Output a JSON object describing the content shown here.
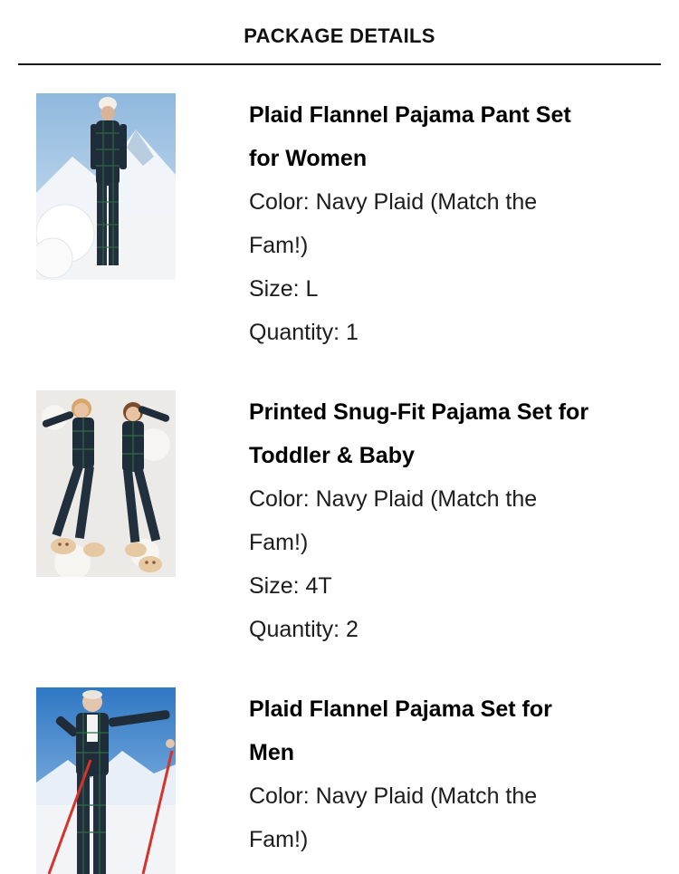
{
  "header": {
    "title": "PACKAGE DETAILS"
  },
  "items": [
    {
      "name_lines": [
        "Plaid Flannel Pajama Pant Set",
        "for Women"
      ],
      "color_lines": [
        "Color: Navy Plaid (Match the",
        "Fam!)"
      ],
      "size": "Size: L",
      "quantity": "Quantity: 1",
      "image_icon": "woman-in-plaid-pajamas-photo"
    },
    {
      "name_lines": [
        "Printed Snug-Fit Pajama Set for",
        "Toddler & Baby"
      ],
      "color_lines": [
        "Color: Navy Plaid (Match the",
        "Fam!)"
      ],
      "size": "Size: 4T",
      "quantity": "Quantity: 2",
      "image_icon": "kids-in-plaid-pajamas-photo"
    },
    {
      "name_lines": [
        "Plaid Flannel Pajama Set for",
        "Men"
      ],
      "color_lines": [
        "Color: Navy Plaid (Match the",
        "Fam!)"
      ],
      "image_icon": "man-in-plaid-pajamas-photo"
    }
  ],
  "colors": {
    "plaid_navy": "#1f2c3a",
    "plaid_green": "#2f5a3e",
    "sky_blue": "#a9c9e6",
    "snow": "#eef1f4"
  }
}
